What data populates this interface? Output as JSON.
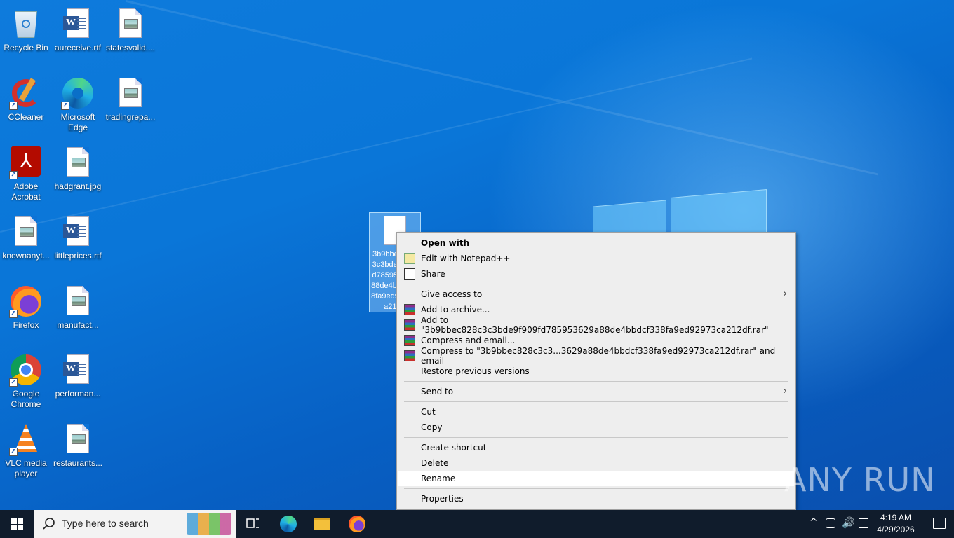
{
  "desktop": {
    "icons": [
      {
        "label": "Recycle Bin",
        "icon": "recycle-bin-icon"
      },
      {
        "label": "aureceive.rtf",
        "icon": "word-document-icon"
      },
      {
        "label": "statesvalid....",
        "icon": "image-file-icon"
      },
      {
        "label": "CCleaner",
        "icon": "ccleaner-icon"
      },
      {
        "label": "Microsoft Edge",
        "icon": "edge-icon"
      },
      {
        "label": "tradingrepa...",
        "icon": "image-file-icon"
      },
      {
        "label": "Adobe Acrobat",
        "icon": "acrobat-icon"
      },
      {
        "label": "hadgrant.jpg",
        "icon": "image-file-icon"
      },
      {
        "label": "knownanyt...",
        "icon": "image-file-icon"
      },
      {
        "label": "littleprices.rtf",
        "icon": "word-document-icon"
      },
      {
        "label": "Firefox",
        "icon": "firefox-icon"
      },
      {
        "label": "manufact...",
        "icon": "image-file-icon"
      },
      {
        "label": "Google Chrome",
        "icon": "chrome-icon"
      },
      {
        "label": "performan...",
        "icon": "word-document-icon"
      },
      {
        "label": "VLC media player",
        "icon": "vlc-icon"
      },
      {
        "label": "restaurants...",
        "icon": "image-file-icon"
      }
    ],
    "selected_file": {
      "label": "3b9bbec828c3c3bde9f909fd785953629a88de4bbdcf338fa9ed92973ca212df"
    }
  },
  "context_menu": {
    "items": [
      {
        "label": "Open with",
        "icon": "",
        "bold": true
      },
      {
        "label": "Edit with Notepad++",
        "icon": "notepadpp-icon"
      },
      {
        "label": "Share",
        "icon": "share-icon"
      },
      {
        "label": "Give access to",
        "submenu": true
      },
      {
        "label": "Add to archive...",
        "icon": "winrar-icon"
      },
      {
        "label": "Add to \"3b9bbec828c3c3bde9f909fd785953629a88de4bbdcf338fa9ed92973ca212df.rar\"",
        "icon": "winrar-icon"
      },
      {
        "label": "Compress and email...",
        "icon": "winrar-icon"
      },
      {
        "label": "Compress to \"3b9bbec828c3c3...3629a88de4bbdcf338fa9ed92973ca212df.rar\" and email",
        "icon": "winrar-icon"
      },
      {
        "label": "Restore previous versions"
      },
      {
        "label": "Send to",
        "submenu": true
      },
      {
        "label": "Cut"
      },
      {
        "label": "Copy"
      },
      {
        "label": "Create shortcut"
      },
      {
        "label": "Delete"
      },
      {
        "label": "Rename",
        "highlighted": true
      },
      {
        "label": "Properties"
      }
    ]
  },
  "watermark": "ANY RUN",
  "taskbar": {
    "search_placeholder": "Type here to search",
    "pinned_apps": [
      "task-view-icon",
      "edge-icon",
      "file-explorer-icon",
      "firefox-icon"
    ],
    "clock": {
      "time": "4:19 AM",
      "date": "4/29/2026"
    }
  }
}
